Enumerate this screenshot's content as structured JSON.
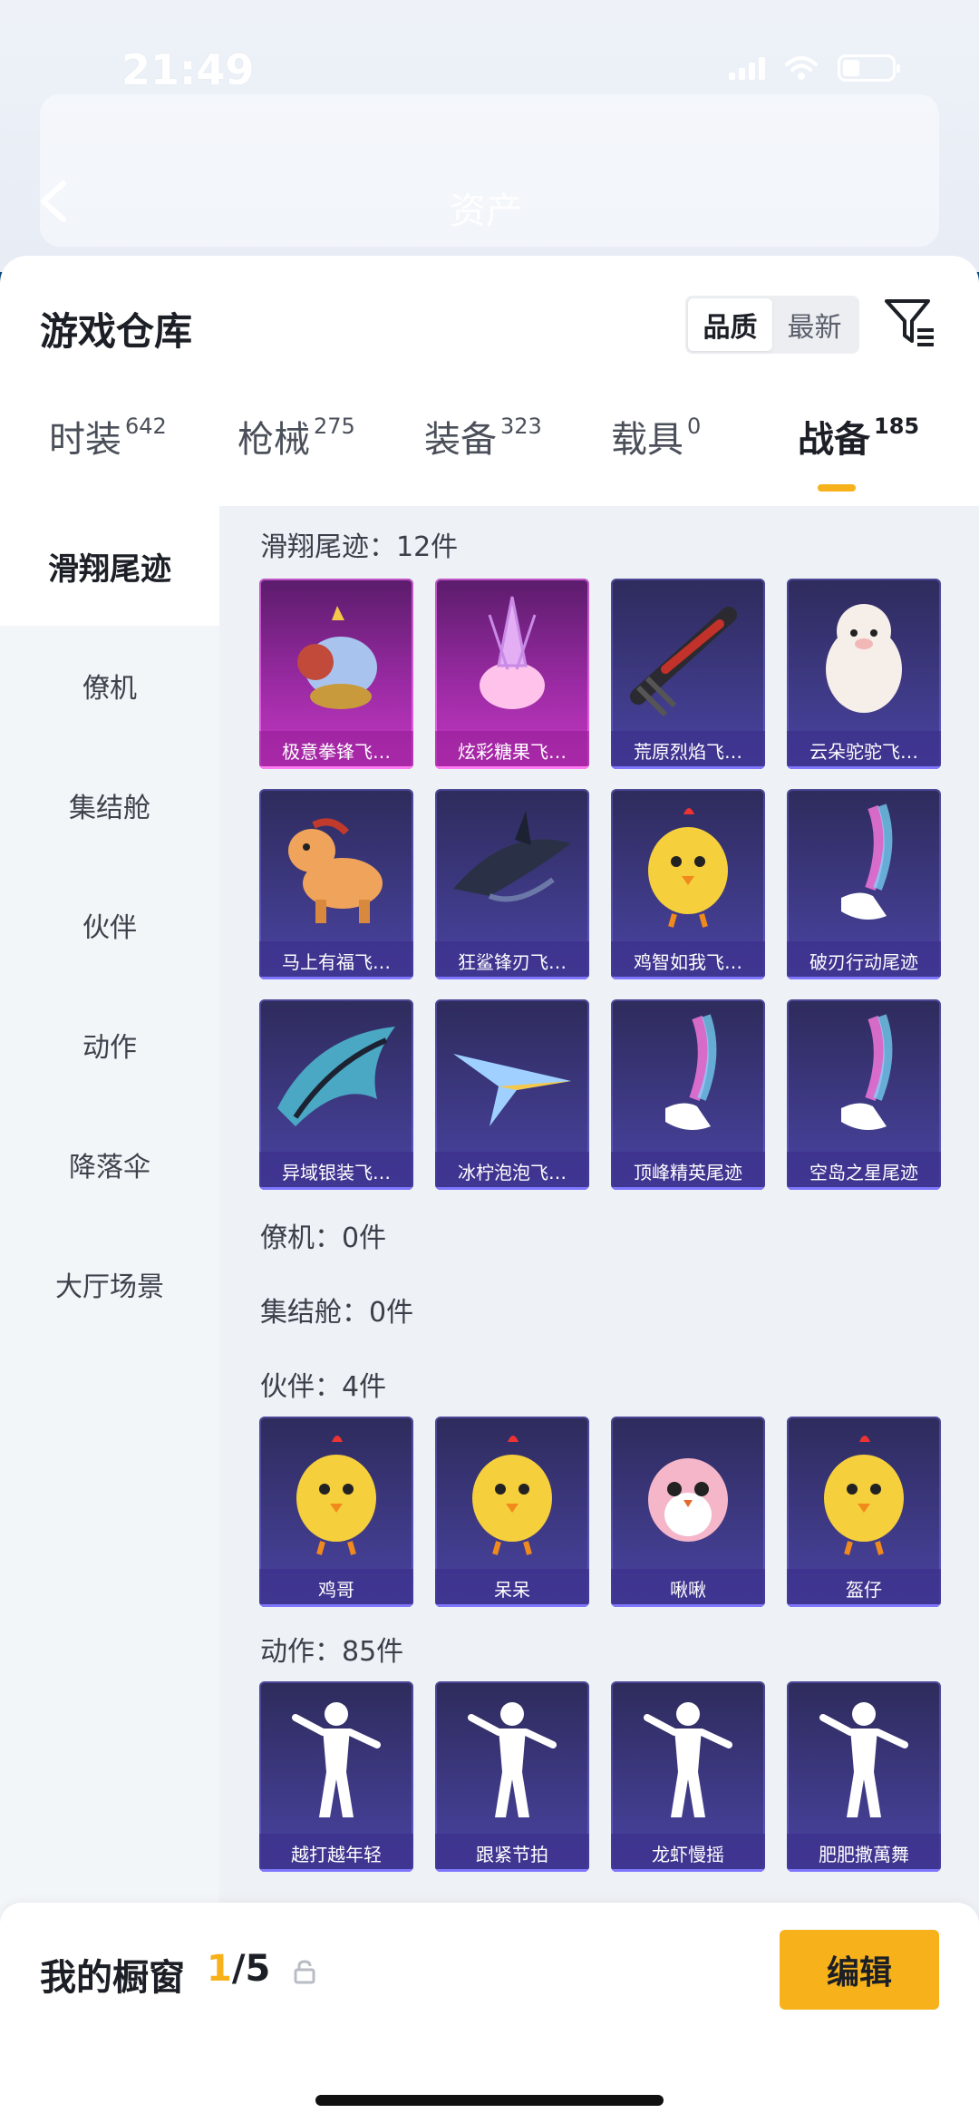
{
  "status_bar": {
    "time": "21:49"
  },
  "header": {
    "title": "资产"
  },
  "sheet": {
    "title": "游戏仓库",
    "sort_options": [
      {
        "label": "品质",
        "active": true
      },
      {
        "label": "最新",
        "active": false
      }
    ]
  },
  "tabs": [
    {
      "label": "时装",
      "count": "642"
    },
    {
      "label": "枪械",
      "count": "275"
    },
    {
      "label": "装备",
      "count": "323"
    },
    {
      "label": "载具",
      "count": "0"
    },
    {
      "label": "战备",
      "count": "185",
      "active": true
    }
  ],
  "sidebar": {
    "items": [
      {
        "label": "滑翔尾迹",
        "active": true
      },
      {
        "label": "僚机"
      },
      {
        "label": "集结舱"
      },
      {
        "label": "伙伴"
      },
      {
        "label": "动作"
      },
      {
        "label": "降落伞"
      },
      {
        "label": "大厅场景"
      }
    ]
  },
  "sections": {
    "trails": {
      "title": "滑翔尾迹：12件",
      "items": [
        {
          "name": "极意拳锋飞…",
          "quality": "pink",
          "art": "elephant-boxer"
        },
        {
          "name": "炫彩糖果飞…",
          "quality": "pink",
          "art": "crystal-candy"
        },
        {
          "name": "荒原烈焰飞…",
          "quality": "purple",
          "art": "flame-glider"
        },
        {
          "name": "云朵驼驼飞…",
          "quality": "purple",
          "art": "alpaca"
        },
        {
          "name": "马上有福飞…",
          "quality": "purple",
          "art": "pony"
        },
        {
          "name": "狂鲨锋刃飞…",
          "quality": "purple",
          "art": "shark"
        },
        {
          "name": "鸡智如我飞…",
          "quality": "purple",
          "art": "chicken-gold"
        },
        {
          "name": "破刃行动尾迹",
          "quality": "purple",
          "art": "smoke-trail"
        },
        {
          "name": "异域银装飞…",
          "quality": "purple",
          "art": "wing-blade"
        },
        {
          "name": "冰柠泡泡飞…",
          "quality": "purple",
          "art": "paper-plane"
        },
        {
          "name": "顶峰精英尾迹",
          "quality": "purple",
          "art": "smoke-trail"
        },
        {
          "name": "空岛之星尾迹",
          "quality": "purple",
          "art": "smoke-trail"
        }
      ]
    },
    "wingman": {
      "title": "僚机：0件"
    },
    "pod": {
      "title": "集结舱：0件"
    },
    "companions": {
      "title": "伙伴：4件",
      "items": [
        {
          "name": "鸡哥",
          "quality": "purple",
          "art": "chicken-glasses"
        },
        {
          "name": "呆呆",
          "quality": "purple",
          "art": "chick"
        },
        {
          "name": "啾啾",
          "quality": "purple",
          "art": "bird-pink"
        },
        {
          "name": "盔仔",
          "quality": "purple",
          "art": "chicken-helmet"
        }
      ]
    },
    "emotes": {
      "title": "动作：85件",
      "items": [
        {
          "name": "越打越年轻",
          "quality": "purple",
          "art": "dancer"
        },
        {
          "name": "跟紧节拍",
          "quality": "purple",
          "art": "dancer"
        },
        {
          "name": "龙虾慢摇",
          "quality": "purple",
          "art": "dancer"
        },
        {
          "name": "肥肥撒萬舞",
          "quality": "purple",
          "art": "dancer"
        }
      ]
    }
  },
  "bottom_bar": {
    "label": "我的橱窗",
    "count_current": "1",
    "count_total": "/5",
    "edit_label": "编辑"
  },
  "colors": {
    "accent": "#f6b11b",
    "pink_quality": "#c53ac4",
    "purple_quality": "#4a44a4"
  },
  "icons": [
    "back-arrow-icon",
    "filter-icon",
    "lock-icon",
    "share-icon"
  ]
}
